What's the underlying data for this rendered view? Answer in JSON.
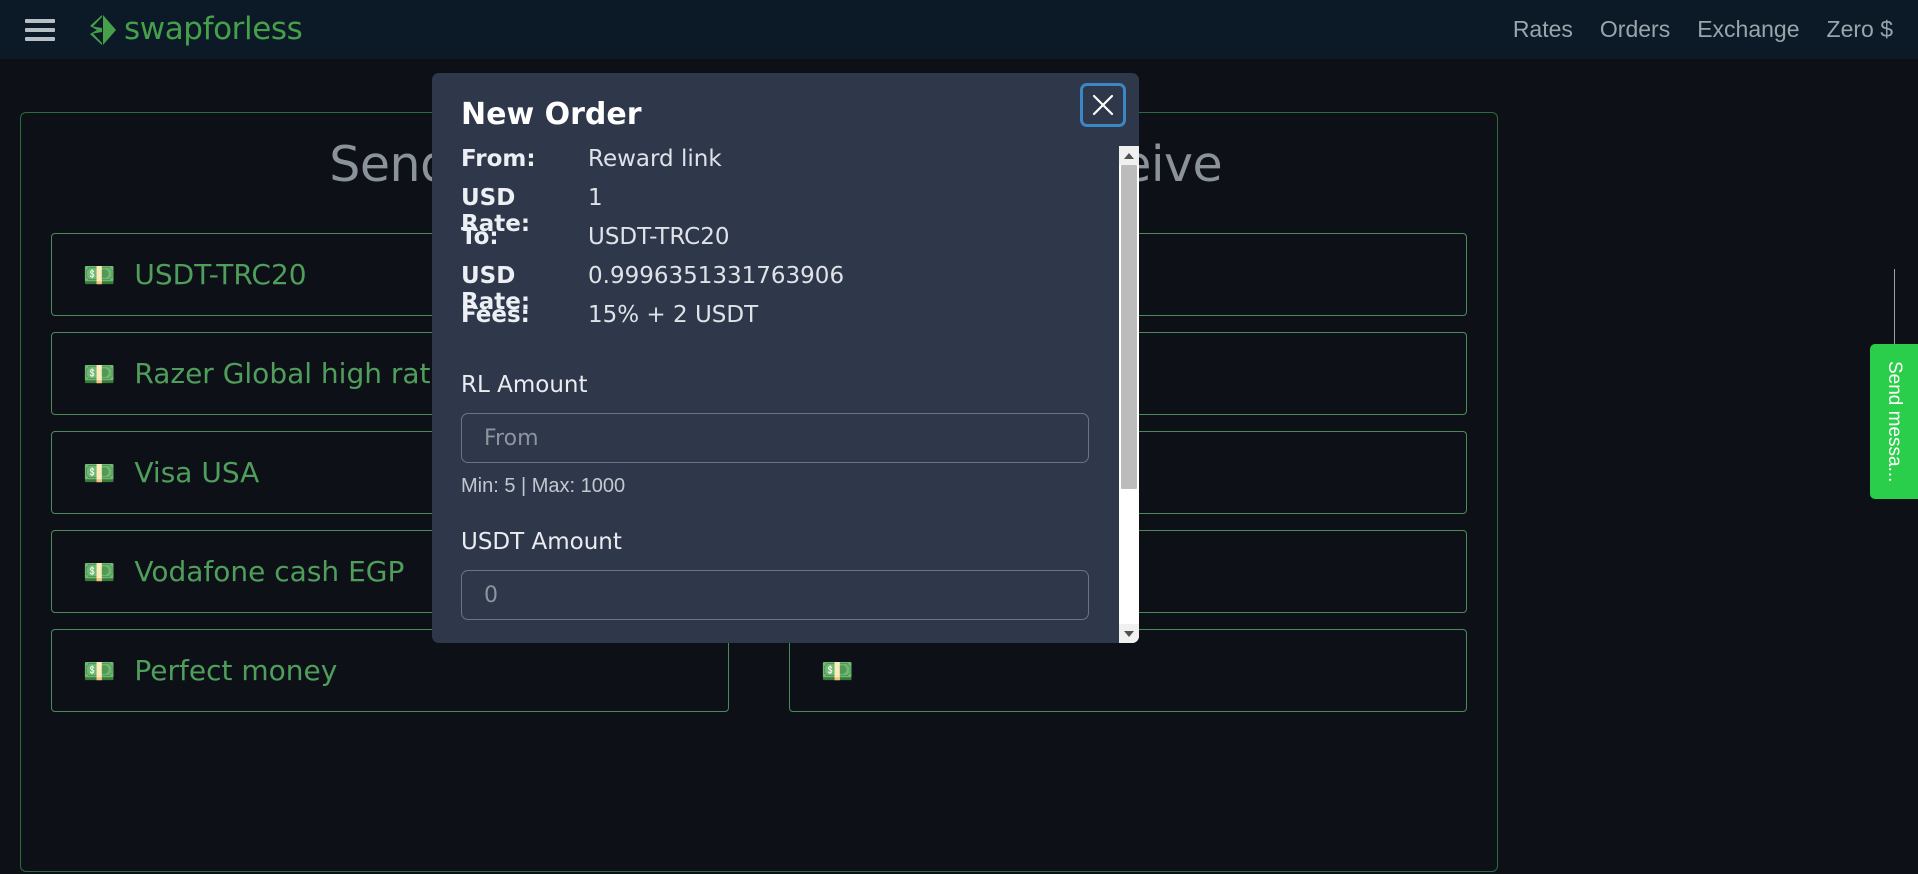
{
  "nav": {
    "menu_icon": "hamburger-menu-icon",
    "brand": "swapforless",
    "brand_icon": "gem-icon",
    "links": [
      {
        "label": "Rates"
      },
      {
        "label": "Orders"
      },
      {
        "label": "Exchange"
      },
      {
        "label": "Zero $"
      }
    ]
  },
  "exchange": {
    "send_heading": "Send",
    "receive_heading": "Receive",
    "send_methods": [
      {
        "icon": "banknote-icon",
        "label": "USDT-TRC20"
      },
      {
        "icon": "banknote-icon",
        "label": "Razer Global high rate"
      },
      {
        "icon": "banknote-icon",
        "label": "Visa USA"
      },
      {
        "icon": "banknote-icon",
        "label": "Vodafone cash EGP"
      },
      {
        "icon": "banknote-icon",
        "label": "Perfect money"
      }
    ],
    "receive_methods": [
      {
        "icon": "banknote-icon",
        "label": ""
      },
      {
        "icon": "banknote-icon",
        "label": ""
      },
      {
        "icon": "banknote-icon",
        "label": ""
      },
      {
        "icon": "banknote-icon",
        "label": ""
      },
      {
        "icon": "banknote-icon",
        "label": ""
      }
    ]
  },
  "chat_widget": {
    "label": "Send messa...",
    "accent_color": "#2bce4a"
  },
  "modal": {
    "title": "New Order",
    "close_icon": "close-icon",
    "details": [
      {
        "label": "From:",
        "value": "Reward link"
      },
      {
        "label": "USD Rate:",
        "value": "1"
      },
      {
        "label": "To:",
        "value": "USDT-TRC20"
      },
      {
        "label": "USD Rate:",
        "value": "0.9996351331763906"
      },
      {
        "label": "Fees:",
        "value": "15% + 2 USDT"
      }
    ],
    "from_field": {
      "label": "RL Amount",
      "placeholder": "From",
      "value": "",
      "helper": "Min: 5 | Max: 1000"
    },
    "to_field": {
      "label": "USDT Amount",
      "placeholder": "0",
      "value": ""
    },
    "scrollbar": {
      "up_icon": "scroll-up-arrow-icon",
      "down_icon": "scroll-down-arrow-icon"
    }
  },
  "colors": {
    "brand_green": "#46a04a",
    "accent_green": "#2bce4a",
    "focus_blue": "#3d86c6",
    "modal_bg": "#2f384b",
    "page_bg": "#0d1117",
    "nav_bg": "#0b1a26"
  }
}
